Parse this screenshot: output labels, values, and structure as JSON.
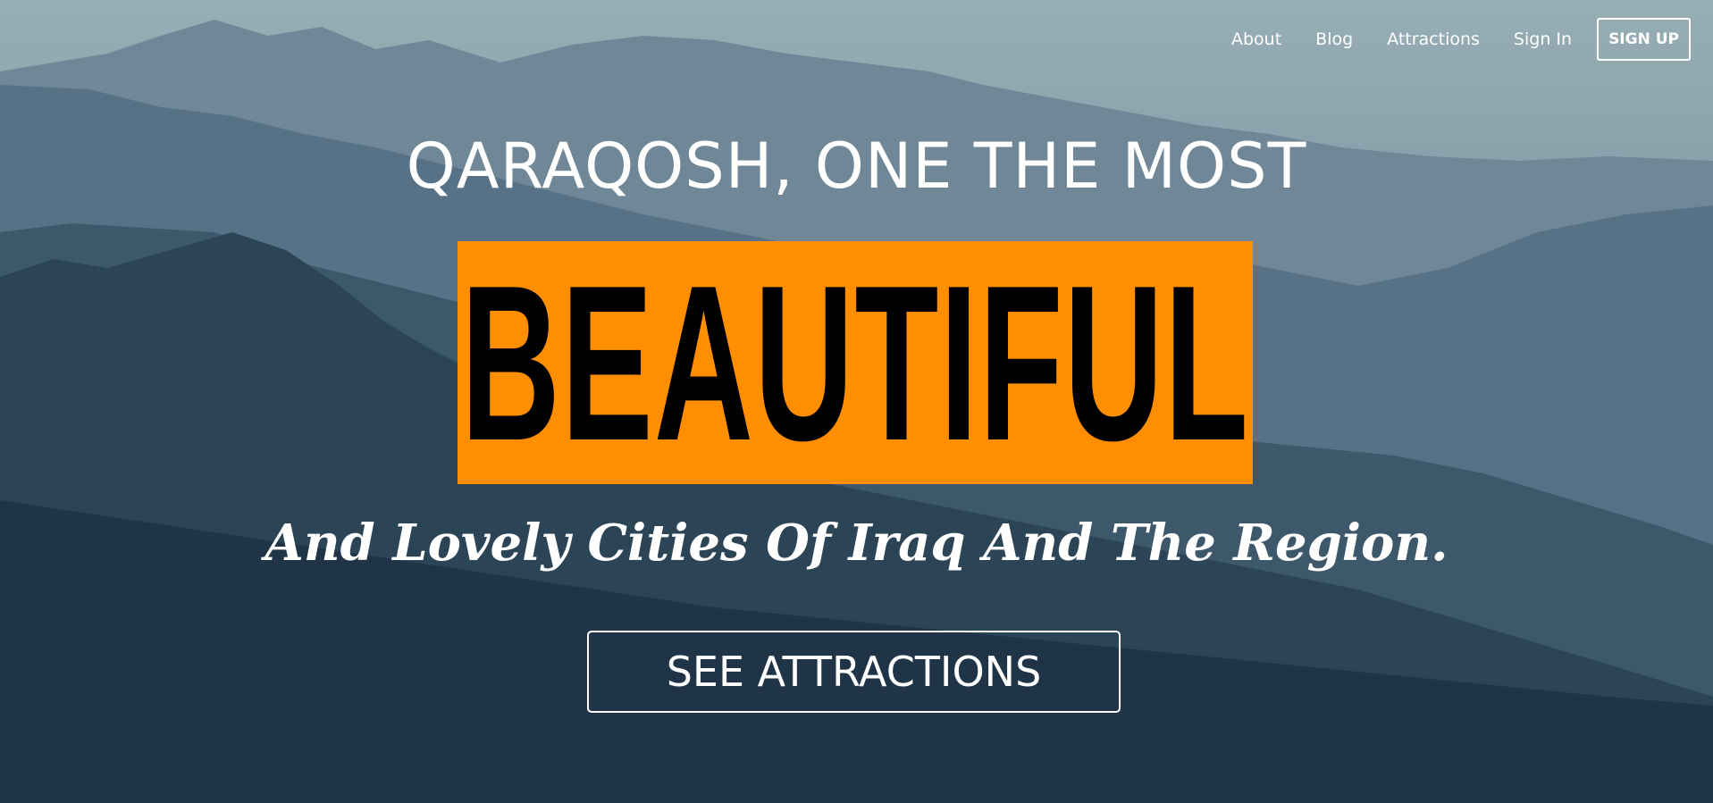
{
  "nav": {
    "items": [
      {
        "label": "About"
      },
      {
        "label": "Blog"
      },
      {
        "label": "Attractions"
      },
      {
        "label": "Sign In"
      }
    ],
    "signup_label": "SIGN UP"
  },
  "hero": {
    "headline": "QARAQOSH, ONE THE MOST",
    "highlight_word": "BEAUTIFUL",
    "subline": "And Lovely Cities Of Iraq And The Region.",
    "cta_label": "SEE ATTRACTIONS",
    "highlight_color": "#ff8f00"
  },
  "background": {
    "icon": "mountain-landscape",
    "sky_color": "#8fa9b2",
    "valley_color": "#1e3546"
  }
}
